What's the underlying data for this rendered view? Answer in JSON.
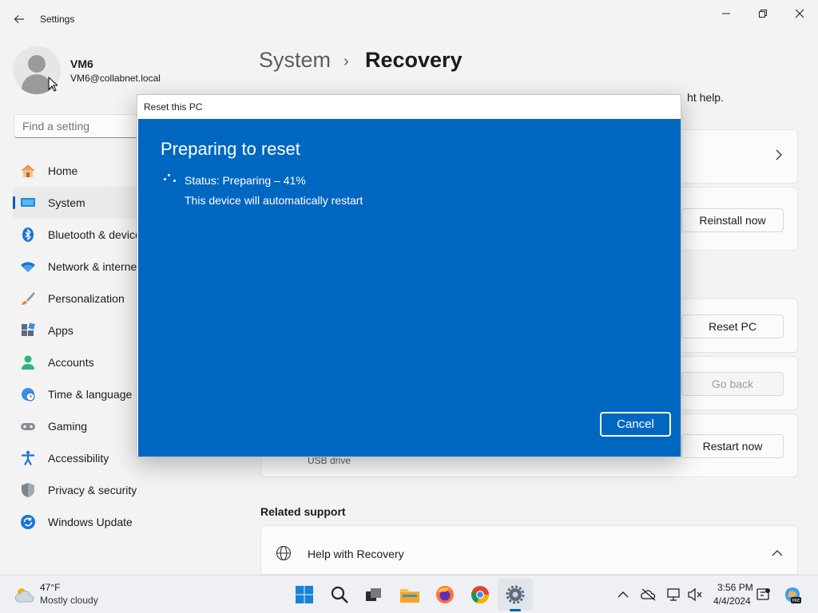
{
  "window": {
    "title": "Settings",
    "back_icon": "back-arrow-icon",
    "minimize_icon": "minimize-icon",
    "maximize_icon": "restore-icon",
    "close_icon": "close-icon"
  },
  "user": {
    "name": "VM6",
    "email": "VM6@collabnet.local"
  },
  "search": {
    "placeholder": "Find a setting"
  },
  "sidebar": {
    "items": [
      {
        "label": "Home",
        "icon": "home-icon"
      },
      {
        "label": "System",
        "icon": "system-icon",
        "active": true
      },
      {
        "label": "Bluetooth & devices",
        "icon": "bluetooth-icon"
      },
      {
        "label": "Network & internet",
        "icon": "wifi-icon"
      },
      {
        "label": "Personalization",
        "icon": "brush-icon"
      },
      {
        "label": "Apps",
        "icon": "apps-icon"
      },
      {
        "label": "Accounts",
        "icon": "accounts-icon"
      },
      {
        "label": "Time & language",
        "icon": "clock-globe-icon"
      },
      {
        "label": "Gaming",
        "icon": "gamepad-icon"
      },
      {
        "label": "Accessibility",
        "icon": "accessibility-icon"
      },
      {
        "label": "Privacy & security",
        "icon": "shield-icon"
      },
      {
        "label": "Windows Update",
        "icon": "update-icon"
      }
    ]
  },
  "main": {
    "breadcrumb_parent": "System",
    "breadcrumb_separator": "›",
    "breadcrumb_current": "Recovery",
    "intro_tail": "ht help.",
    "reinstall_button": "Reinstall now",
    "reset_button": "Reset PC",
    "goback_button": "Go back",
    "restart_button": "Restart now",
    "usb_label": "USB drive",
    "related_heading": "Related support",
    "help_label": "Help with Recovery"
  },
  "dialog": {
    "title": "Reset this PC",
    "heading": "Preparing to reset",
    "status": "Status: Preparing – 41%",
    "progress_percent": 41,
    "restart_note": "This device will automatically restart",
    "cancel_label": "Cancel",
    "accent_color": "#0067c0"
  },
  "taskbar": {
    "weather_temp": "47°F",
    "weather_desc": "Mostly cloudy",
    "pinned": [
      "start-icon",
      "search-icon",
      "task-view-icon",
      "file-explorer-icon",
      "firefox-icon",
      "chrome-icon",
      "settings-icon"
    ],
    "time": "3:56 PM",
    "date": "4/4/2024",
    "pre_badge": "PRE"
  }
}
